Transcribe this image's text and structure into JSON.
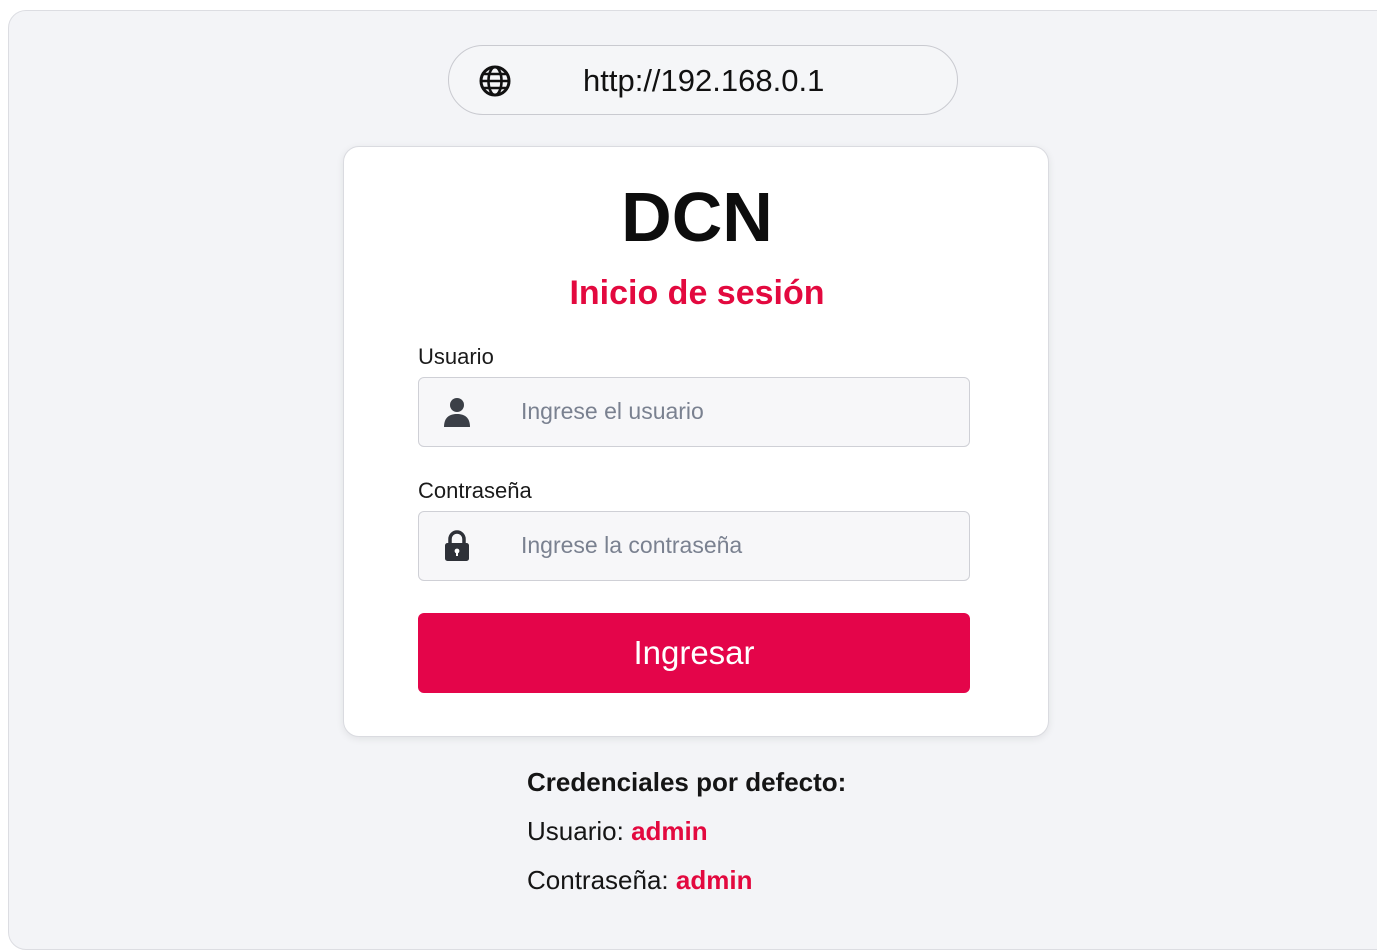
{
  "browser": {
    "url": "http://192.168.0.1",
    "globe_icon": "globe-icon"
  },
  "login": {
    "brand": "DCN",
    "title": "Inicio de sesión",
    "username_label": "Usuario",
    "username_placeholder": "Ingrese el usuario",
    "username_value": "",
    "username_icon": "user-icon",
    "password_label": "Contraseña",
    "password_placeholder": "Ingrese la contraseña",
    "password_value": "",
    "password_icon": "lock-icon",
    "submit_label": "Ingresar"
  },
  "defaults": {
    "title": "Credenciales por defecto:",
    "user_label": "Usuario:",
    "user_value": "admin",
    "pass_label": "Contraseña:",
    "pass_value": "admin"
  },
  "colors": {
    "accent": "#e4054a",
    "accent_text": "#e3093f",
    "background": "#f3f4f7",
    "card": "#ffffff"
  }
}
